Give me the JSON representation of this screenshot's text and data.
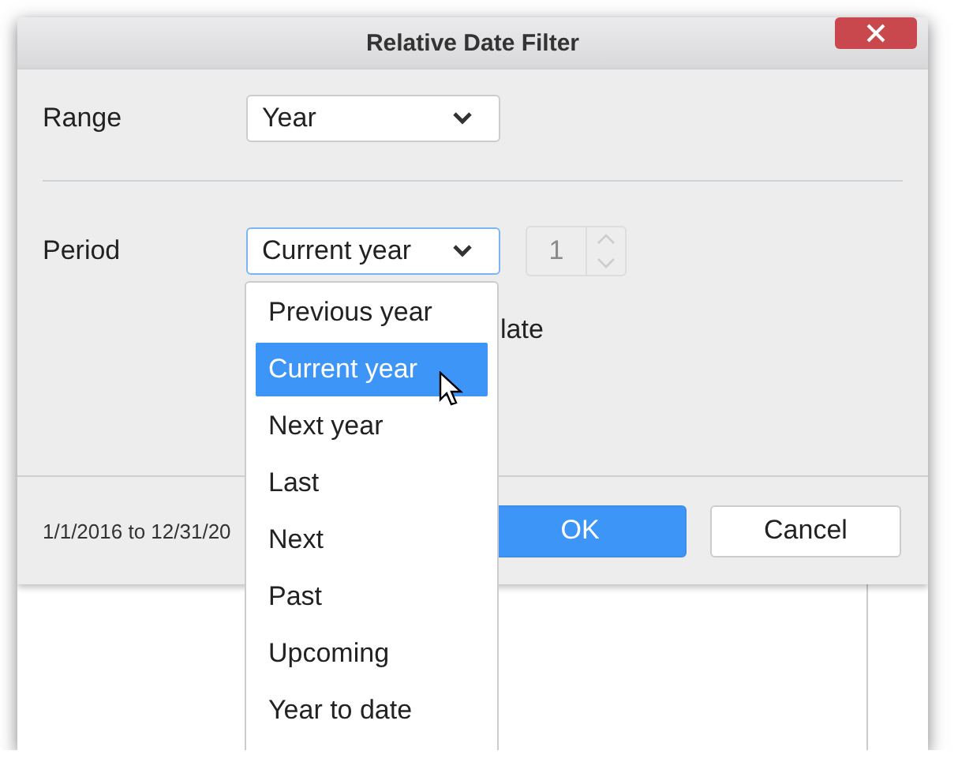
{
  "window": {
    "title": "Relative Date Filter"
  },
  "range": {
    "label": "Range",
    "value": "Year"
  },
  "period": {
    "label": "Period",
    "value": "Current year",
    "focused": true,
    "expanded": true,
    "options": [
      {
        "label": "Previous year",
        "selected": false
      },
      {
        "label": "Current year",
        "selected": true
      },
      {
        "label": "Next year",
        "selected": false
      },
      {
        "label": "Last",
        "selected": false
      },
      {
        "label": "Next",
        "selected": false
      },
      {
        "label": "Past",
        "selected": false
      },
      {
        "label": "Upcoming",
        "selected": false
      },
      {
        "label": "Year to date",
        "selected": false
      }
    ]
  },
  "count": {
    "value": "1",
    "disabled": true
  },
  "option_label": "late",
  "footer": {
    "date_range": "1/1/2016 to 12/31/20",
    "buttons": [
      {
        "label": "OK",
        "kind": "primary"
      },
      {
        "label": "Cancel",
        "kind": "secondary"
      }
    ]
  }
}
